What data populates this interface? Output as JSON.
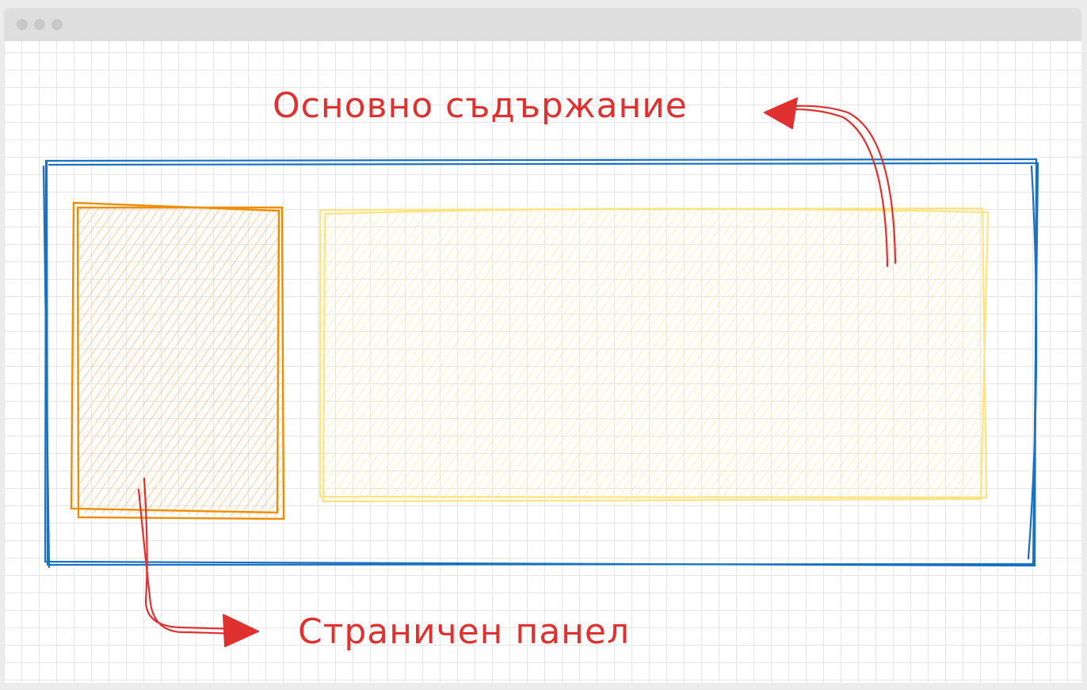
{
  "labels": {
    "main_content": "Основно съдържание",
    "sidebar": "Страничен панел"
  },
  "colors": {
    "outer_frame": "#1971c2",
    "sidebar_stroke": "#f08c00",
    "sidebar_fill": "#ffc078",
    "main_stroke": "#ffe380",
    "main_fill": "#ffec99",
    "annotation": "#e03131",
    "grid": "#e6e6e6"
  }
}
